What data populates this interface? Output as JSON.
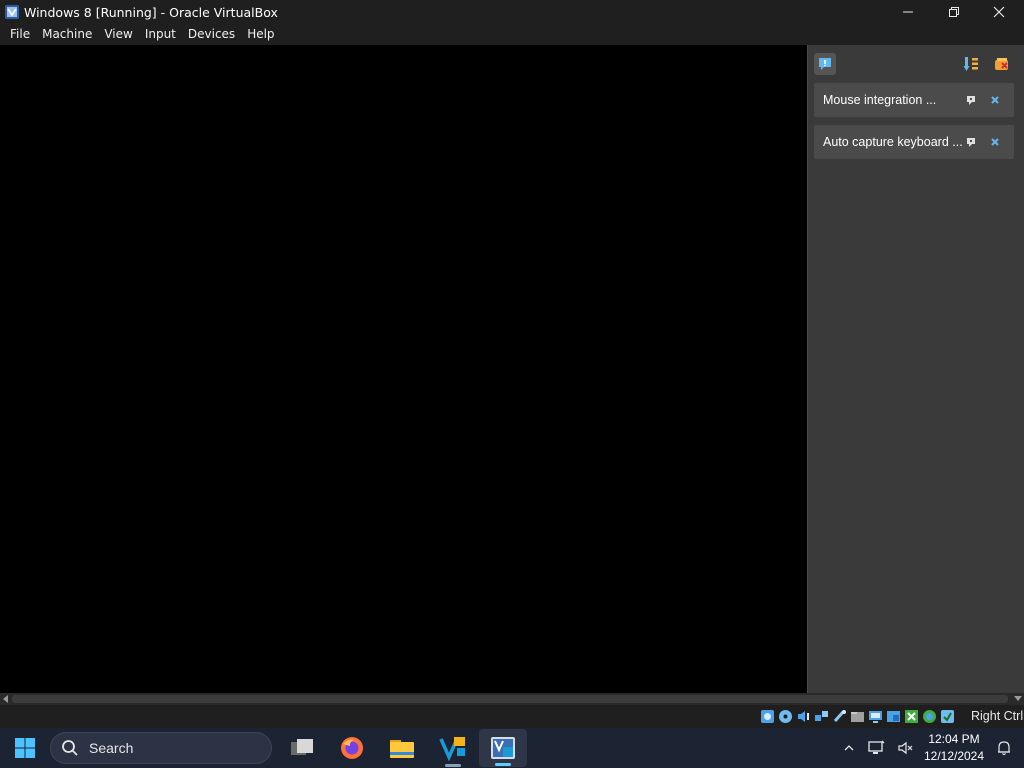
{
  "window": {
    "title": "Windows 8 [Running] - Oracle VirtualBox",
    "controls": [
      "minimize",
      "restore",
      "close"
    ]
  },
  "menubar": {
    "items": [
      "File",
      "Machine",
      "View",
      "Input",
      "Devices",
      "Help"
    ]
  },
  "notification_center": {
    "toggle_icon": "exclamation-bubble-icon",
    "sort_icon": "sort-icon",
    "clear_icon": "clear-all-icon",
    "notices": [
      {
        "text": "Mouse integration ...",
        "pin_icon": "pin-icon",
        "close_icon": "close-icon"
      },
      {
        "text": "Auto capture keyboard ...",
        "pin_icon": "pin-icon",
        "close_icon": "close-icon"
      }
    ]
  },
  "statusbar": {
    "indicators": [
      "hard-disk-icon",
      "optical-drive-icon",
      "audio-icon",
      "network-icon",
      "usb-icon",
      "shared-folders-icon",
      "display-icon",
      "recording-icon",
      "capture-icon",
      "mouse-integration-icon",
      "keyboard-icon",
      "cpu-icon"
    ],
    "host_key": "Right Ctrl"
  },
  "taskbar": {
    "start_icon": "windows-start-icon",
    "search_placeholder": "Search",
    "apps": [
      "task-view-icon",
      "firefox-icon",
      "file-explorer-icon",
      "virtualbox-manager-icon",
      "virtualbox-vm-icon"
    ],
    "tray": {
      "chevron_icon": "chevron-up-icon",
      "network_icon": "network-icon",
      "volume_icon": "volume-muted-icon",
      "time": "12:04 PM",
      "date": "12/12/2024",
      "notifications_icon": "bell-icon"
    }
  },
  "colors": {
    "accent": "#60cdff",
    "chrome": "#1f1f1f",
    "panel": "#3a3a3a"
  }
}
